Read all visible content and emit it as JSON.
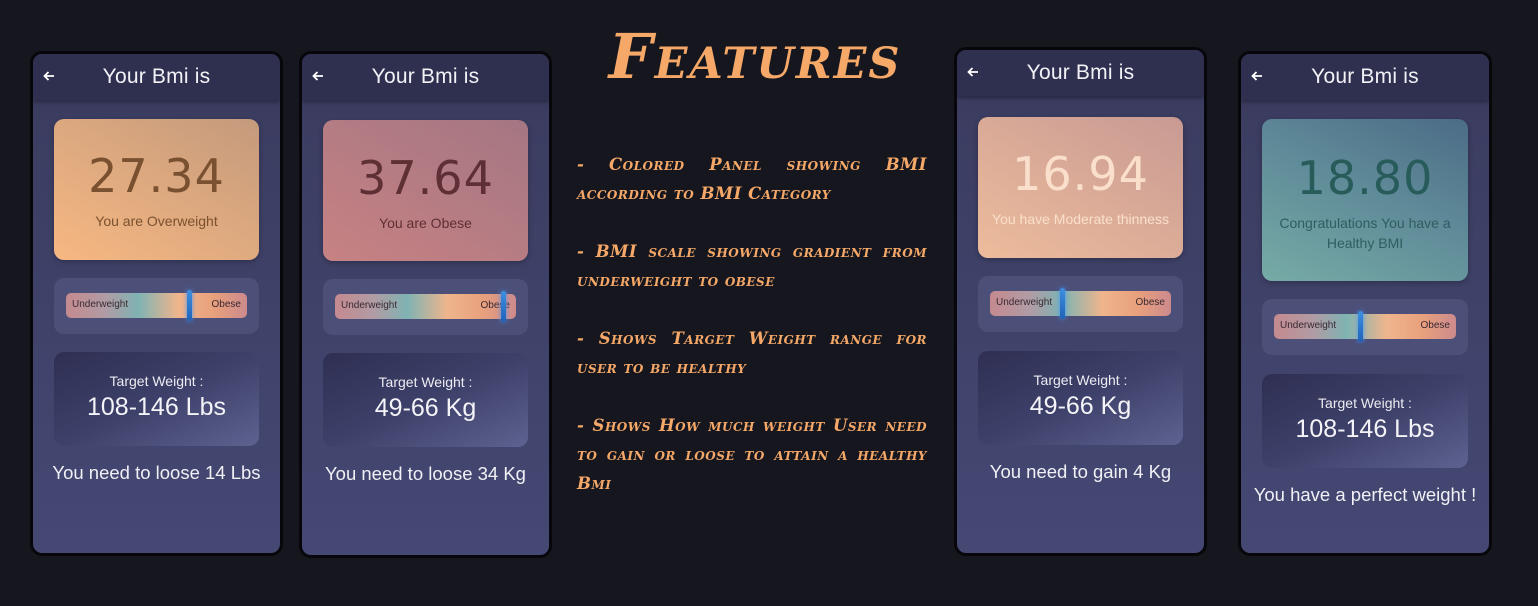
{
  "heading": "Features",
  "features": [
    "- Colored Panel showing BMI according to BMI Category",
    "- BMI scale showing gradient from underweight to obese",
    "- Shows Target Weight range for user to be healthy",
    "- Shows How much weight User need to gain or loose to attain a healthy Bmi"
  ],
  "colors": {
    "background": "#16161e",
    "accent": "#f5a868",
    "phone_background": "#3e4168",
    "app_bar": "#2f3050",
    "scale_marker": "#2f7fd6"
  },
  "icons": {
    "back": "arrow-left-icon"
  },
  "screens": [
    {
      "appbar_title": "Your Bmi is",
      "bmi": "27.34",
      "category": "You are Overweight",
      "panel_colors": [
        "#c49a7c",
        "#f7b882"
      ],
      "bmi_text_color": "#7a5130",
      "scale": {
        "left_label": "Underweight",
        "right_label": "Obese",
        "marker_fraction": 0.68
      },
      "target_label": "Target Weight :",
      "target_value": "108-146 Lbs",
      "advice": "You need to loose 14 Lbs"
    },
    {
      "appbar_title": "Your Bmi is",
      "bmi": "37.64",
      "category": "You are Obese",
      "panel_colors": [
        "#c58283",
        "#ab7a86"
      ],
      "bmi_text_color": "#5e2f34",
      "scale": {
        "left_label": "Underweight",
        "right_label": "Obese",
        "marker_fraction": 0.93
      },
      "target_label": "Target Weight :",
      "target_value": "49-66 Kg",
      "advice": "You need to loose 34 Kg"
    },
    {
      "appbar_title": "Your Bmi is",
      "bmi": "16.94",
      "category": "You have Moderate thinness",
      "panel_colors": [
        "#edbc9c",
        "#c89a93"
      ],
      "bmi_text_color": "#fae0cc",
      "scale": {
        "left_label": "Underweight",
        "right_label": "Obese",
        "marker_fraction": 0.4
      },
      "target_label": "Target Weight :",
      "target_value": "49-66 Kg",
      "advice": "You need to gain 4 Kg"
    },
    {
      "appbar_title": "Your Bmi is",
      "bmi": "18.80",
      "category": "Congratulations You have a Healthy BMI",
      "panel_colors": [
        "#4b6c86",
        "#76aba6"
      ],
      "bmi_text_color": "#285c5b",
      "scale": {
        "left_label": "Underweight",
        "right_label": "Obese",
        "marker_fraction": 0.47
      },
      "target_label": "Target Weight :",
      "target_value": "108-146 Lbs",
      "advice": "You have a perfect weight !"
    }
  ]
}
